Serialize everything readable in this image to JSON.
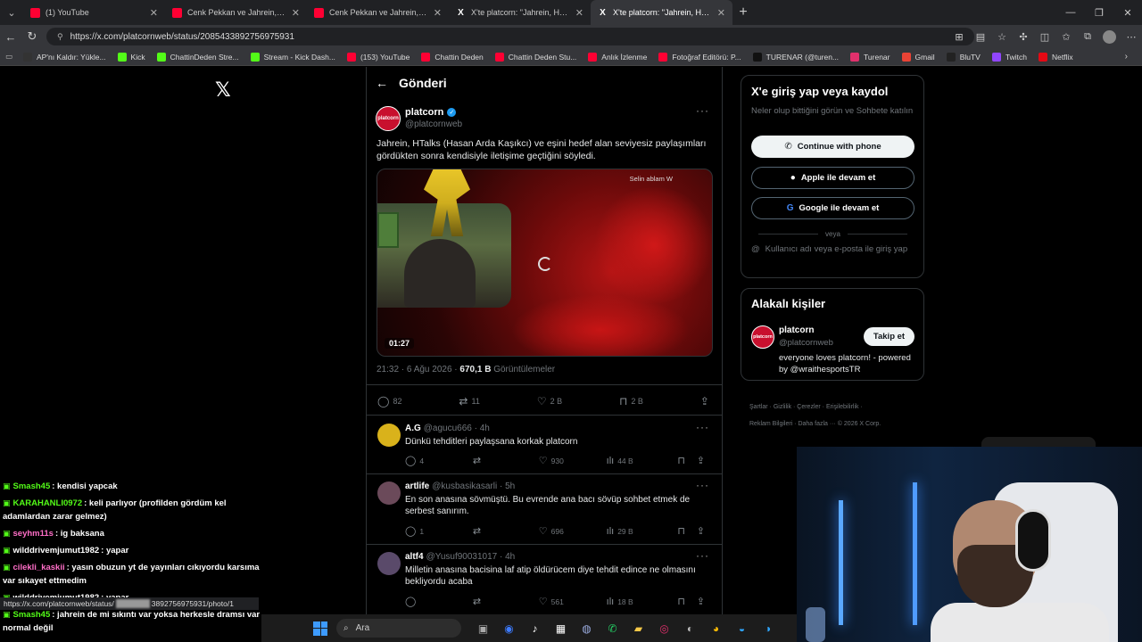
{
  "tabs": [
    {
      "label": "(1) YouTube",
      "icon": "youtube-icon",
      "active": false
    },
    {
      "label": "Cenk Pekkan ve Jahrein, canlı yayın",
      "icon": "youtube-icon",
      "active": false
    },
    {
      "label": "Cenk Pekkan ve Jahrein, canlı yayın",
      "icon": "youtube-icon",
      "active": false
    },
    {
      "label": "X'te platcorn: \"Jahrein, HTalks (Has",
      "icon": "x-icon",
      "active": false
    },
    {
      "label": "X'te platcorn: \"Jahrein, HTalks (Has",
      "icon": "x-icon",
      "active": true
    }
  ],
  "address": {
    "url": "https://x.com/platcornweb/status/2085433892756975931"
  },
  "bookmarks": [
    {
      "label": "AP'nı Kaldır: Yükle...",
      "color": "#333333"
    },
    {
      "label": "Kick",
      "color": "#53fc18"
    },
    {
      "label": "ChattinDeden Stre...",
      "color": "#53fc18"
    },
    {
      "label": "Stream - Kick Dash...",
      "color": "#53fc18"
    },
    {
      "label": "(153) YouTube",
      "color": "#ff0033"
    },
    {
      "label": "Chattin Deden",
      "color": "#ff0033"
    },
    {
      "label": "Chattin Deden Stu...",
      "color": "#ff0033"
    },
    {
      "label": "Anlık İzlenme",
      "color": "#ff0033"
    },
    {
      "label": "Fotoğraf Editörü: P...",
      "color": "#ff0033"
    },
    {
      "label": "TURENAR (@turen...",
      "color": "#111111"
    },
    {
      "label": "Turenar",
      "color": "#e1306c"
    },
    {
      "label": "Gmail",
      "color": "#ea4335"
    },
    {
      "label": "BluTV",
      "color": "#222222"
    },
    {
      "label": "Twitch",
      "color": "#9146ff"
    },
    {
      "label": "Netflix",
      "color": "#e50914"
    }
  ],
  "main": {
    "title": "Gönderi",
    "post": {
      "avatar_text": "platcorn",
      "name": "platcorn",
      "handle": "@platcornweb",
      "text": "Jahrein, HTalks (Hasan Arda Kaşıkcı) ve eşini hedef alan seviyesiz paylaşımları gördükten sonra kendisiyle iletişime geçtiğini söyledi.",
      "media_label": "Selin ablam W",
      "duration": "01:27",
      "time": "21:32 · 6 Ağu 2026 · ",
      "views": "670,1 B",
      "views_label": " Görüntülemeler",
      "replies": "82",
      "reposts": "11",
      "likes": "2 B",
      "bookmarks": "2 B"
    },
    "replies": [
      {
        "name": "A.G",
        "handle": "@agucu666 · 4h",
        "text": "Dünkü tehditleri paylaşsana korkak platcorn",
        "replies": "4",
        "reposts": "",
        "likes": "930",
        "views": "44 B",
        "avatar_color": "#d9b21b"
      },
      {
        "name": "artlife",
        "handle": "@kusbasikasarli · 5h",
        "text": "En son anasına sövmüştü. Bu evrende ana bacı sövüp sohbet etmek de serbest sanırım.",
        "replies": "1",
        "reposts": "",
        "likes": "696",
        "views": "29 B",
        "avatar_color": "#6b4a5a"
      },
      {
        "name": "altf4",
        "handle": "@Yusuf90031017 · 4h",
        "text": "Milletin anasına bacisina laf atip öldürücem diye tehdit edince ne olmasını bekliyordu acaba",
        "replies": "",
        "reposts": "",
        "likes": "561",
        "views": "18 B",
        "avatar_color": "#5a4a6a"
      }
    ]
  },
  "login": {
    "title": "X'e giriş yap veya kaydol",
    "subtitle": "Neler olup bittiğini görün ve Sohbete katılın",
    "phone": "Continue with phone",
    "apple": "Apple ile devam et",
    "google": "Google ile devam et",
    "or": "veya",
    "username": "Kullanıcı adı veya e-posta ile giriş yap"
  },
  "people": {
    "title": "Alakalı kişiler",
    "name": "platcorn",
    "handle": "@platcornweb",
    "follow": "Takip et",
    "bio": "everyone loves platcorn! - powered by @wraithesportsTR"
  },
  "footer": {
    "line1": "Şartlar · Gizlilik · Çerezler · Erişilebilirlik ·",
    "line2": "Reklam Bilgileri · Daha fazla ··· © 2026 X Corp."
  },
  "chat": [
    {
      "user": "Smash45",
      "color": "#53fc18",
      "text": ": kendisi yapcak"
    },
    {
      "user": "KARAHANLI0972",
      "color": "#53fc18",
      "text": ": keli parlıyor (profilden gördüm kel adamlardan zarar gelmez)"
    },
    {
      "user": "seyhm11s",
      "color": "#ff6ec7",
      "text": ": ig baksana"
    },
    {
      "user": "wilddrivemjumut1982",
      "color": "#ffffff",
      "text": ": yapar"
    },
    {
      "user": "cilekli_kaskii",
      "color": "#ff6ec7",
      "text": ": yasın obuzun yt de yayınları cıkıyordu karsıma var sıkayet ettmedim"
    },
    {
      "user": "wilddrivemjumut1982",
      "color": "#ffffff",
      "text": ": yapar"
    },
    {
      "user": "Smash45",
      "color": "#53fc18",
      "text": ": jahrein de mi sıkıntı var yoksa herkesle dramsı var normal değil"
    }
  ],
  "status_url": {
    "prefix": "https://x.com/platcornweb/status/",
    "suffix": "3892756975931/photo/1"
  },
  "taskbar": {
    "search": "Ara"
  }
}
